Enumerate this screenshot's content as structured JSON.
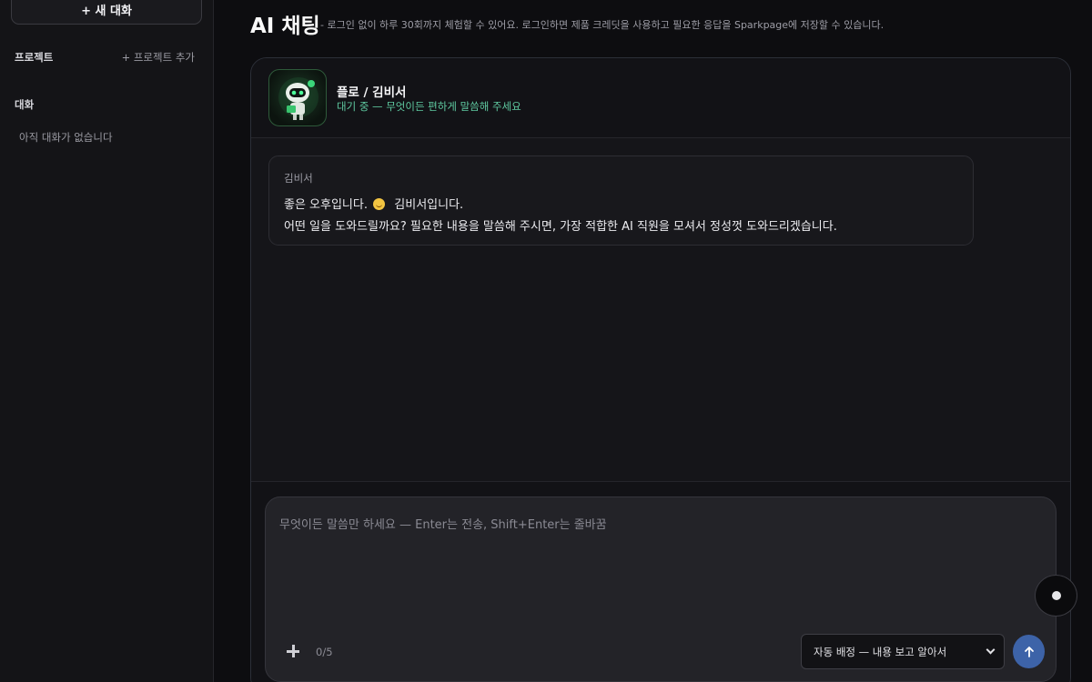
{
  "sidebar": {
    "new_chat_label": "+ 새 대화",
    "projects_heading": "프로젝트",
    "add_project_label": "+ 프로젝트 추가",
    "chats_heading": "대화",
    "empty_chats_text": "아직 대화가 없습니다"
  },
  "page": {
    "title": "AI 채팅",
    "subtitle": "- 로그인 없이 하루 30회까지 체험할 수 있어요. 로그인하면 제품 크레딧을 사용하고 필요한 응답을 Sparkpage에 저장할 수 있습니다."
  },
  "agent": {
    "name": "플로 / 김비서",
    "status": "대기 중 — 무엇이든 편하게 말씀해 주세요",
    "avatar_icon": "robot-avatar-icon"
  },
  "message": {
    "sender": "김비서",
    "line1_before_emoji": "좋은 오후입니다.",
    "emoji": "smiling-face-icon",
    "line1_after_emoji": "김비서입니다.",
    "line2": "어떤 일을 도와드릴까요? 필요한 내용을 말씀해 주시면, 가장 적합한 AI 직원을 모셔서 정성껏 도와드리겠습니다."
  },
  "composer": {
    "value": "",
    "placeholder": "무엇이든 말씀만 하세요 — Enter는 전송, Shift+Enter는 줄바꿈",
    "attachment_count": "0/5",
    "route_selected": "자동 배정 — 내용 보고 알아서",
    "send_icon": "arrow-up-icon",
    "attach_icon": "plus-icon"
  },
  "colors": {
    "background": "#0d0d10",
    "accent_status": "#5fc9a0",
    "send_button": "#3d63a8"
  }
}
